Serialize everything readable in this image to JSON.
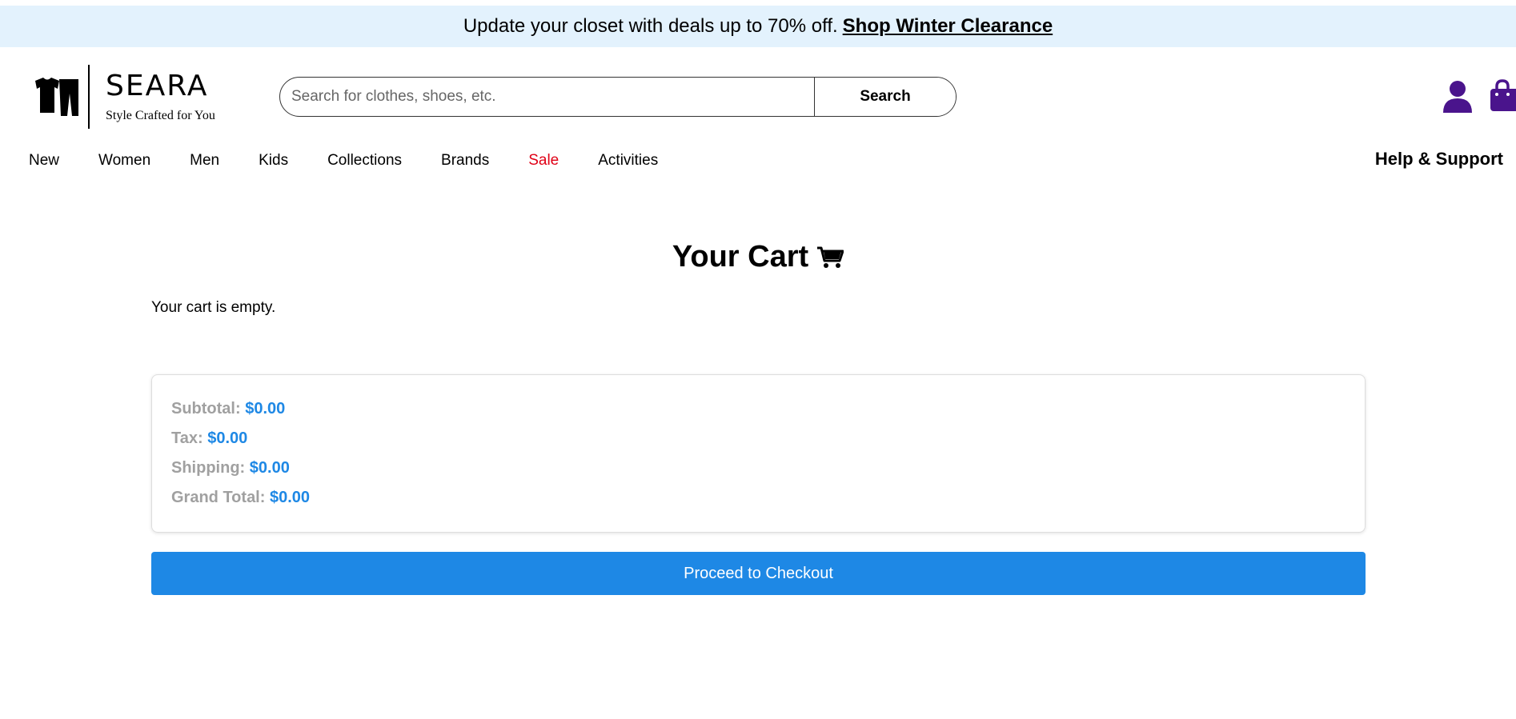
{
  "promo": {
    "text": "Update your closet with deals up to 70% off.",
    "link": "Shop Winter Clearance"
  },
  "logo": {
    "name": "SEARA",
    "tagline": "Style Crafted for You"
  },
  "search": {
    "placeholder": "Search for clothes, shoes, etc.",
    "button_label": "Search"
  },
  "icons": {
    "brand_color": "#4a148c"
  },
  "nav": {
    "items": [
      "New",
      "Women",
      "Men",
      "Kids",
      "Collections",
      "Brands",
      "Sale",
      "Activities"
    ],
    "sale_color": "#e00016",
    "help": "Help & Support"
  },
  "cart": {
    "title": "Your Cart",
    "empty_message": "Your cart is empty.",
    "summary": {
      "subtotal_label": "Subtotal:",
      "subtotal_value": "$0.00",
      "tax_label": "Tax:",
      "tax_value": "$0.00",
      "shipping_label": "Shipping:",
      "shipping_value": "$0.00",
      "grand_total_label": "Grand Total:",
      "grand_total_value": "$0.00"
    },
    "checkout_label": "Proceed to Checkout",
    "accent_color": "#1e88e5"
  }
}
